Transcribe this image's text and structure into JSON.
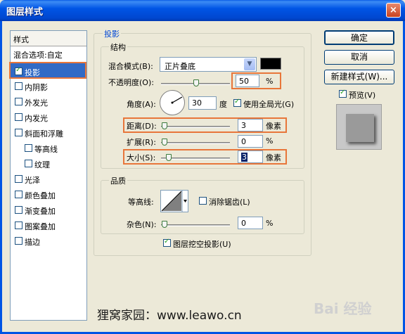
{
  "window": {
    "title": "图层样式",
    "close_label": "×"
  },
  "styles_panel": {
    "header": "样式",
    "blend_item": "混合选项:自定",
    "items": [
      {
        "label": "投影",
        "checked": true,
        "selected": true
      },
      {
        "label": "内阴影",
        "checked": false
      },
      {
        "label": "外发光",
        "checked": false
      },
      {
        "label": "内发光",
        "checked": false
      },
      {
        "label": "斜面和浮雕",
        "checked": false
      },
      {
        "label": "等高线",
        "checked": false
      },
      {
        "label": "纹理",
        "checked": false
      },
      {
        "label": "光泽",
        "checked": false
      },
      {
        "label": "颜色叠加",
        "checked": false
      },
      {
        "label": "渐变叠加",
        "checked": false
      },
      {
        "label": "图案叠加",
        "checked": false
      },
      {
        "label": "描边",
        "checked": false
      }
    ]
  },
  "drop_shadow": {
    "section_title": "投影",
    "structure_title": "结构",
    "blend_mode_label": "混合模式(B):",
    "blend_mode_value": "正片叠底",
    "shadow_color": "#000000",
    "opacity_label": "不透明度(O):",
    "opacity_value": "50",
    "opacity_unit": "%",
    "angle_label": "角度(A):",
    "angle_value": "30",
    "angle_unit": "度",
    "global_light_label": "使用全局光(G)",
    "global_light_checked": true,
    "distance_label": "距离(D):",
    "distance_value": "3",
    "distance_unit": "像素",
    "spread_label": "扩展(R):",
    "spread_value": "0",
    "spread_unit": "%",
    "size_label": "大小(S):",
    "size_value": "3",
    "size_unit": "像素",
    "quality_title": "品质",
    "contour_label": "等高线:",
    "anti_alias_label": "消除锯齿(L)",
    "anti_alias_checked": false,
    "noise_label": "杂色(N):",
    "noise_value": "0",
    "noise_unit": "%",
    "knockout_label": "图层挖空投影(U)",
    "knockout_checked": true
  },
  "buttons": {
    "ok": "确定",
    "cancel": "取消",
    "new_style": "新建样式(W)..."
  },
  "preview": {
    "label": "预览(V)",
    "checked": true
  },
  "watermark": {
    "text": "狸窝家园：www.leawo.cn",
    "baidu": "Bai 经验"
  },
  "colors": {
    "highlight": "#e8763a",
    "selection": "#316ac5",
    "titlebar": "#0055e5"
  }
}
